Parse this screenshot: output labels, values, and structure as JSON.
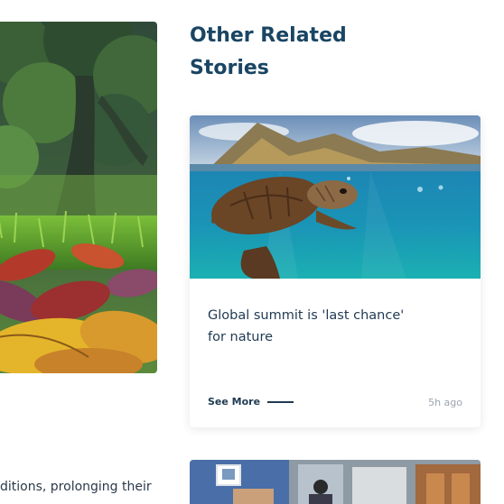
{
  "section": {
    "title_line1": "Other Related",
    "title_line2": "Stories"
  },
  "hero": {
    "image_icon": "autumn-leaves-tree-photo"
  },
  "article": {
    "body_fragment": "ditions, prolonging their"
  },
  "stories": [
    {
      "image_icon": "sea-turtle-photo",
      "headline_line1": "Global summit is 'last chance'",
      "headline_line2": "for nature",
      "see_more_label": "See More",
      "time_ago": "5h ago"
    },
    {
      "image_icon": "classroom-photo"
    }
  ],
  "colors": {
    "title": "#1a4563",
    "text": "#1f3a52",
    "muted": "#9aa5b1"
  }
}
